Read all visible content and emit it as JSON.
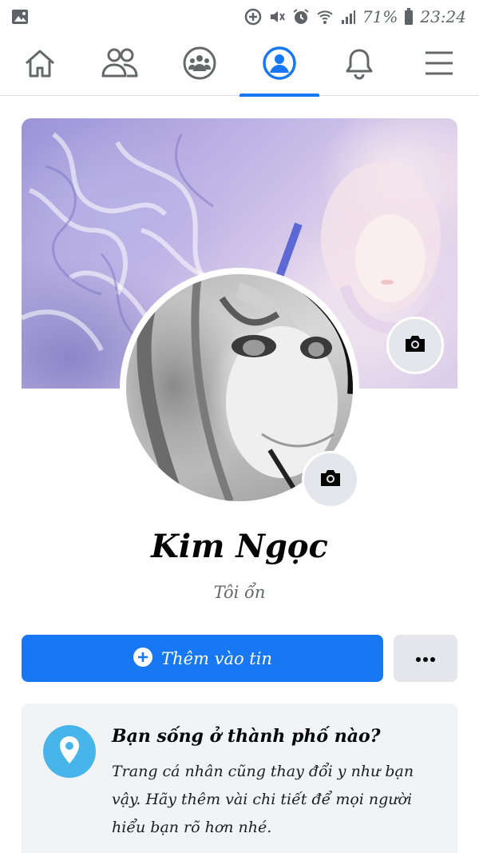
{
  "status_bar": {
    "battery": "71%",
    "time": "23:24",
    "icons": [
      "image-icon",
      "data-saver-icon",
      "mute-icon",
      "alarm-icon",
      "wifi-icon",
      "signal-icon",
      "battery-icon"
    ]
  },
  "nav": {
    "items": [
      {
        "name": "home-icon"
      },
      {
        "name": "friends-icon"
      },
      {
        "name": "groups-icon"
      },
      {
        "name": "profile-icon",
        "active": true
      },
      {
        "name": "notifications-icon"
      },
      {
        "name": "menu-icon"
      }
    ],
    "accent": "#1877f2"
  },
  "profile": {
    "name": "Kim Ngọc",
    "bio": "Tôi ổn",
    "cover_camera_icon": "camera-icon",
    "avatar_camera_icon": "camera-icon"
  },
  "actions": {
    "add_story_label": "Thêm vào tin",
    "add_story_icon": "plus-circle-icon",
    "more_icon": "more-dots-icon"
  },
  "info_card": {
    "title": "Bạn sống ở thành phố nào?",
    "text": "Trang cá nhân cũng thay đổi y như bạn vậy. Hãy thêm vài chi tiết để mọi người hiểu bạn rõ hơn nhé.",
    "icon": "location-pin-icon",
    "icon_color": "#47b5ea"
  }
}
